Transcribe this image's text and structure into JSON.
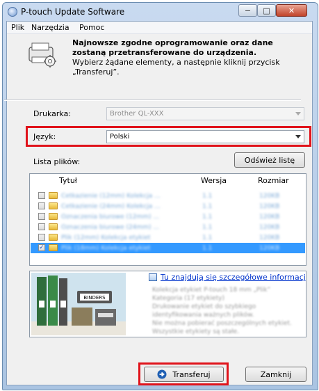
{
  "window": {
    "title": "P-touch Update Software",
    "min_glyph": "−",
    "max_glyph": "□",
    "close_glyph": "✕"
  },
  "menu": {
    "items": [
      "Plik",
      "Narzędzia",
      "Pomoc"
    ]
  },
  "header": {
    "line1": "Najnowsze zgodne oprogramowanie oraz dane",
    "line2": "zostaną przetransferowane do urządzenia.",
    "line3": "Wybierz żądane elementy, a następnie kliknij przycisk",
    "line4": "„Transferuj”.",
    "icon": "printer-update-icon"
  },
  "printer": {
    "label": "Drukarka:",
    "value": "Brother QL-XXX"
  },
  "language": {
    "label": "Język:",
    "value": "Polski"
  },
  "file_list": {
    "label": "Lista plików:",
    "refresh_label": "Odśwież listę",
    "columns": [
      "Tytuł",
      "Wersja",
      "Rozmiar"
    ],
    "rows": [
      {
        "checked": false,
        "title": "Cetkazienie (12mm) Kolekcja ...",
        "version": "1.1",
        "size": "120KB",
        "selected": false
      },
      {
        "checked": false,
        "title": "Cetkazienie (24mm) Kolekcja ...",
        "version": "1.1",
        "size": "120KB",
        "selected": false
      },
      {
        "checked": false,
        "title": "Oznaczenia biurowe (12mm) ...",
        "version": "1.1",
        "size": "120KB",
        "selected": false
      },
      {
        "checked": false,
        "title": "Oznaczenia biurowe (24mm) ...",
        "version": "1.1",
        "size": "120KB",
        "selected": false
      },
      {
        "checked": false,
        "title": "Plik (12mm) Kolekcja etykiet",
        "version": "1.1",
        "size": "120KB",
        "selected": false
      },
      {
        "checked": true,
        "title": "Plik (18mm) Kolekcja etykiet",
        "version": "1.1",
        "size": "120KB",
        "selected": true
      }
    ],
    "check_glyph": "✓"
  },
  "details": {
    "link": "Tu znajdują się szczegółowe informacje.",
    "lines": [
      "Kolekcja etykiet P-touch 18 mm „Plik”",
      "Kategoria (17 etykiety)",
      "Drukowanie etykiet do szybkiego",
      "identyfikowania ważnych plików.",
      "Nie można pobierać poszczególnych etykiet.",
      "Wszystkie etykiety są stałe."
    ],
    "photo_label": "BINDERS"
  },
  "buttons": {
    "transfer": "Transferuj",
    "close": "Zamknij"
  },
  "colors": {
    "highlight": "#e0131b",
    "selection": "#3399ff",
    "link": "#0033cc"
  }
}
